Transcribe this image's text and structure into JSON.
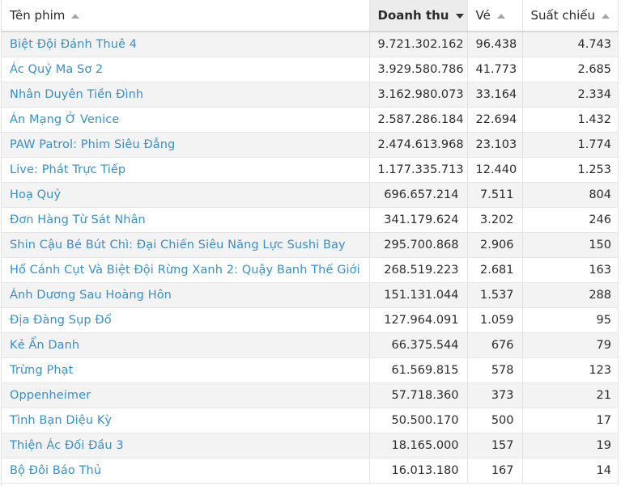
{
  "table": {
    "columns": [
      {
        "label": "Tên phim",
        "sort": "asc"
      },
      {
        "label": "Doanh thu",
        "sort": "desc"
      },
      {
        "label": "Vé",
        "sort": "asc"
      },
      {
        "label": "Suất chiếu",
        "sort": "asc"
      }
    ],
    "rows": [
      {
        "title": "Biệt Đội Đánh Thuê 4",
        "revenue": "9.721.302.162",
        "tickets": "96.438",
        "screenings": "4.743"
      },
      {
        "title": "Ác Quỷ Ma Sơ 2",
        "revenue": "3.929.580.786",
        "tickets": "41.773",
        "screenings": "2.685"
      },
      {
        "title": "Nhân Duyên Tiền Đình",
        "revenue": "3.162.980.073",
        "tickets": "33.164",
        "screenings": "2.334"
      },
      {
        "title": "Án Mạng Ở Venice",
        "revenue": "2.587.286.184",
        "tickets": "22.694",
        "screenings": "1.432"
      },
      {
        "title": "PAW Patrol: Phim Siêu Đẳng",
        "revenue": "2.474.613.968",
        "tickets": "23.103",
        "screenings": "1.774"
      },
      {
        "title": "Live: Phát Trực Tiếp",
        "revenue": "1.177.335.713",
        "tickets": "12.440",
        "screenings": "1.253"
      },
      {
        "title": "Hoạ Quỷ",
        "revenue": "696.657.214",
        "tickets": "7.511",
        "screenings": "804"
      },
      {
        "title": "Đơn Hàng Từ Sát Nhân",
        "revenue": "341.179.624",
        "tickets": "3.202",
        "screenings": "246"
      },
      {
        "title": "Shin Cậu Bé Bút Chì: Đại Chiến Siêu Năng Lực Sushi Bay",
        "revenue": "295.700.868",
        "tickets": "2.906",
        "screenings": "150"
      },
      {
        "title": "Hổ Cánh Cụt Và Biệt Đội Rừng Xanh 2: Quậy Banh Thế Giới",
        "revenue": "268.519.223",
        "tickets": "2.681",
        "screenings": "163"
      },
      {
        "title": "Ánh Dương Sau Hoàng Hôn",
        "revenue": "151.131.044",
        "tickets": "1.537",
        "screenings": "288"
      },
      {
        "title": "Địa Đàng Sụp Đổ",
        "revenue": "127.964.091",
        "tickets": "1.059",
        "screenings": "95"
      },
      {
        "title": "Kẻ Ẩn Danh",
        "revenue": "66.375.544",
        "tickets": "676",
        "screenings": "79"
      },
      {
        "title": "Trừng Phạt",
        "revenue": "61.569.815",
        "tickets": "578",
        "screenings": "123"
      },
      {
        "title": "Oppenheimer",
        "revenue": "57.718.360",
        "tickets": "373",
        "screenings": "21"
      },
      {
        "title": "Tình Bạn Diệu Kỳ",
        "revenue": "50.500.170",
        "tickets": "500",
        "screenings": "17"
      },
      {
        "title": "Thiện Ác Đối Đầu 3",
        "revenue": "18.165.000",
        "tickets": "157",
        "screenings": "19"
      },
      {
        "title": "Bộ Đôi Báo Thủ",
        "revenue": "16.013.180",
        "tickets": "167",
        "screenings": "14"
      }
    ]
  }
}
